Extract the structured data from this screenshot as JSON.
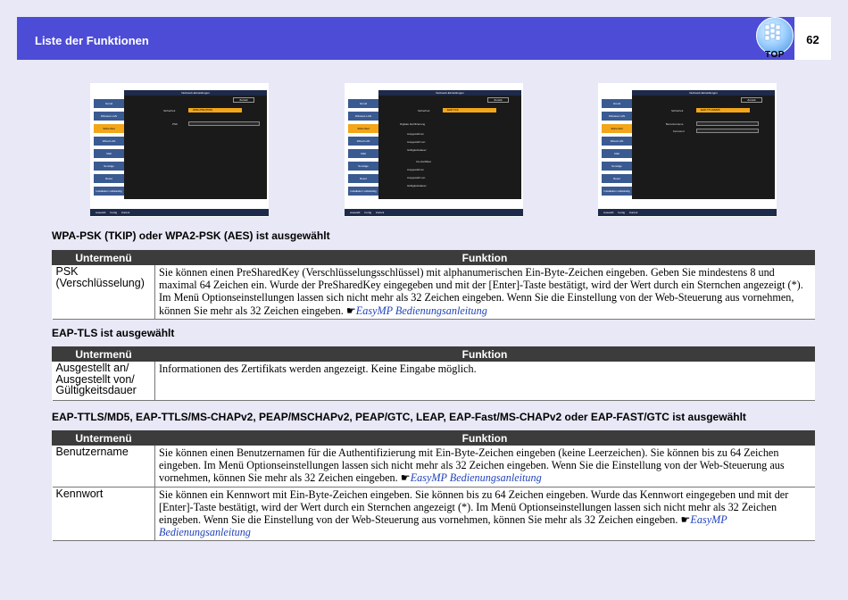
{
  "header": {
    "title": "Liste der Funktionen",
    "page_number": "62",
    "top_button_label": "TOP"
  },
  "screens": [
    {
      "title": "Netzwerk-Einstellungen",
      "sidebar": [
        "Grund",
        "Wireless LAN",
        "Sicherheit",
        "Wired LAN",
        "Mail",
        "Sonstige",
        "Reset",
        "Installation vollständig"
      ],
      "back": "Zurück",
      "row1_label": "Sicherheit",
      "row1_value": "WPA-PSK(TKIP)",
      "row2_label": "PSK",
      "lines": [],
      "footer": [
        "Auswahl",
        "Fertig",
        "Zurück"
      ]
    },
    {
      "title": "Netzwerk-Einstellungen",
      "sidebar": [
        "Grund",
        "Wireless LAN",
        "Sicherheit",
        "Wired LAN",
        "Mail",
        "Sonstige",
        "Reset",
        "Installation vollständig"
      ],
      "back": "Zurück",
      "row1_label": "Sicherheit",
      "row1_value": "EAP-TLS",
      "row2_label": "",
      "lines": [
        "Digitale Zertifizierung",
        "Ausgestellt an",
        "Ausgestellt von",
        "Gültigkeitsdauer",
        "CA-Zertifikat",
        "Ausgestellt an",
        "Ausgestellt von",
        "Gültigkeitsdauer"
      ],
      "footer": [
        "Auswahl",
        "Fertig",
        "Zurück"
      ]
    },
    {
      "title": "Netzwerk-Einstellungen",
      "sidebar": [
        "Grund",
        "Wireless LAN",
        "Sicherheit",
        "Wired LAN",
        "Mail",
        "Sonstige",
        "Reset",
        "Installation vollständig"
      ],
      "back": "Zurück",
      "row1_label": "Sicherheit",
      "row1_value": "EAP-TTLS/MD5",
      "row2_label": "Benutzername",
      "row3_label": "Kennwort",
      "lines": [],
      "footer": [
        "Auswahl",
        "Fertig",
        "Zurück"
      ]
    }
  ],
  "sections": [
    {
      "title": "WPA-PSK (TKIP) oder WPA2-PSK (AES) ist ausgewählt",
      "col_sub": "Untermenü",
      "col_fn": "Funktion",
      "rows": [
        {
          "sub": "PSK (Verschlüsselung)",
          "fn": "Sie können einen PreSharedKey (Verschlüsselungsschlüssel) mit alphanumerischen Ein-Byte-Zeichen eingeben. Geben Sie mindestens 8 und maximal 64 Zeichen ein. Wurde der PreSharedKey eingegeben und mit der [Enter]-Taste bestätigt, wird der Wert durch ein Sternchen angezeigt (*). Im Menü Optionseinstellungen lassen sich nicht mehr als 32 Zeichen eingeben. Wenn Sie die Einstellung von der Web-Steuerung aus vornehmen, können Sie mehr als 32 Zeichen eingeben. ",
          "link": "EasyMP Bedienungsanleitung"
        }
      ]
    },
    {
      "title": "EAP-TLS ist ausgewählt",
      "col_sub": "Untermenü",
      "col_fn": "Funktion",
      "rows": [
        {
          "sub": "Ausgestellt an/ Ausgestellt von/ Gültigkeitsdauer",
          "fn": "Informationen des Zertifikats werden angezeigt. Keine Eingabe möglich.",
          "link": ""
        }
      ]
    },
    {
      "title": "EAP-TTLS/MD5, EAP-TTLS/MS-CHAPv2, PEAP/MSCHAPv2, PEAP/GTC, LEAP, EAP-Fast/MS-CHAPv2 oder EAP-FAST/GTC ist ausgewählt",
      "col_sub": "Untermenü",
      "col_fn": "Funktion",
      "rows": [
        {
          "sub": "Benutzername",
          "fn": "Sie können einen Benutzernamen für die Authentifizierung mit Ein-Byte-Zeichen eingeben (keine Leerzeichen). Sie können bis zu 64 Zeichen eingeben. Im Menü Optionseinstellungen lassen sich nicht mehr als 32 Zeichen eingeben. Wenn Sie die Einstellung von der Web-Steuerung aus vornehmen, können Sie mehr als 32 Zeichen eingeben. ",
          "link": "EasyMP Bedienungsanleitung"
        },
        {
          "sub": "Kennwort",
          "fn": "Sie können ein Kennwort mit Ein-Byte-Zeichen eingeben. Sie können bis zu 64 Zeichen eingeben. Wurde das Kennwort eingegeben und mit der [Enter]-Taste bestätigt, wird der Wert durch ein Sternchen angezeigt (*). Im Menü Optionseinstellungen lassen sich nicht mehr als 32 Zeichen eingeben. Wenn Sie die Einstellung von der Web-Steuerung aus vornehmen, können Sie mehr als 32 Zeichen eingeben. ",
          "link": "EasyMP Bedienungsanleitung"
        }
      ]
    }
  ],
  "link_icon": "pointing-hand-icon"
}
